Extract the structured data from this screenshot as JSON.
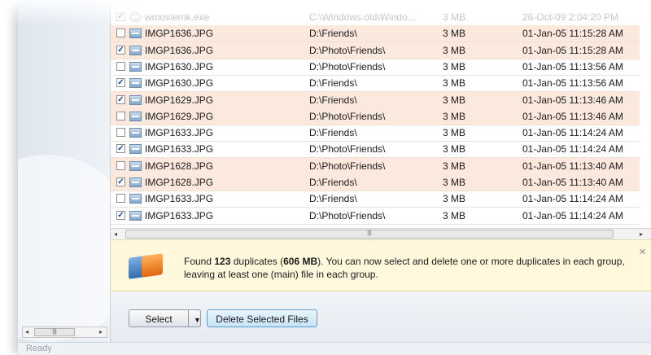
{
  "file_list": {
    "rows": [
      {
        "checked": true,
        "name": "wmoviemk.exe",
        "path": "C:\\Windows.old\\Windo...",
        "size": "3 MB",
        "date": "26-Oct-09 2:04:20 PM",
        "icon": "exe-file-icon",
        "faded": true
      },
      {
        "checked": false,
        "name": "IMGP1636.JPG",
        "path": "D:\\Friends\\",
        "size": "3 MB",
        "date": "01-Jan-05 11:15:28 AM",
        "icon": "image-file-icon"
      },
      {
        "checked": true,
        "name": "IMGP1636.JPG",
        "path": "D:\\Photo\\Friends\\",
        "size": "3 MB",
        "date": "01-Jan-05 11:15:28 AM",
        "icon": "image-file-icon"
      },
      {
        "checked": false,
        "name": "IMGP1630.JPG",
        "path": "D:\\Photo\\Friends\\",
        "size": "3 MB",
        "date": "01-Jan-05 11:13:56 AM",
        "icon": "image-file-icon"
      },
      {
        "checked": true,
        "name": "IMGP1630.JPG",
        "path": "D:\\Friends\\",
        "size": "3 MB",
        "date": "01-Jan-05 11:13:56 AM",
        "icon": "image-file-icon"
      },
      {
        "checked": true,
        "name": "IMGP1629.JPG",
        "path": "D:\\Friends\\",
        "size": "3 MB",
        "date": "01-Jan-05 11:13:46 AM",
        "icon": "image-file-icon"
      },
      {
        "checked": false,
        "name": "IMGP1629.JPG",
        "path": "D:\\Photo\\Friends\\",
        "size": "3 MB",
        "date": "01-Jan-05 11:13:46 AM",
        "icon": "image-file-icon"
      },
      {
        "checked": false,
        "name": "IMGP1633.JPG",
        "path": "D:\\Friends\\",
        "size": "3 MB",
        "date": "01-Jan-05 11:14:24 AM",
        "icon": "image-file-icon"
      },
      {
        "checked": true,
        "name": "IMGP1633.JPG",
        "path": "D:\\Photo\\Friends\\",
        "size": "3 MB",
        "date": "01-Jan-05 11:14:24 AM",
        "icon": "image-file-icon"
      },
      {
        "checked": false,
        "name": "IMGP1628.JPG",
        "path": "D:\\Photo\\Friends\\",
        "size": "3 MB",
        "date": "01-Jan-05 11:13:40 AM",
        "icon": "image-file-icon"
      },
      {
        "checked": true,
        "name": "IMGP1628.JPG",
        "path": "D:\\Friends\\",
        "size": "3 MB",
        "date": "01-Jan-05 11:13:40 AM",
        "icon": "image-file-icon"
      },
      {
        "checked": false,
        "name": "IMGP1633.JPG",
        "path": "D:\\Friends\\",
        "size": "3 MB",
        "date": "01-Jan-05 11:14:24 AM",
        "icon": "image-file-icon"
      },
      {
        "checked": true,
        "name": "IMGP1633.JPG",
        "path": "D:\\Photo\\Friends\\",
        "size": "3 MB",
        "date": "01-Jan-05 11:14:24 AM",
        "icon": "image-file-icon"
      }
    ]
  },
  "info_bar": {
    "text_prefix": "Found ",
    "count": "123",
    "text_middle": " duplicates (",
    "size": "606 MB",
    "text_suffix": "). You can now select and delete one or more duplicates in each group, leaving at least one (main) file in each group.",
    "icon": "duplicate-files-icon"
  },
  "buttons": {
    "select_label": "Select",
    "delete_label": "Delete Selected Files"
  },
  "status_bar": {
    "text": "Ready"
  },
  "colors": {
    "row_highlight": "#fce9dd",
    "info_background": "#fff8dc",
    "delete_button": "#c7e3f7"
  }
}
